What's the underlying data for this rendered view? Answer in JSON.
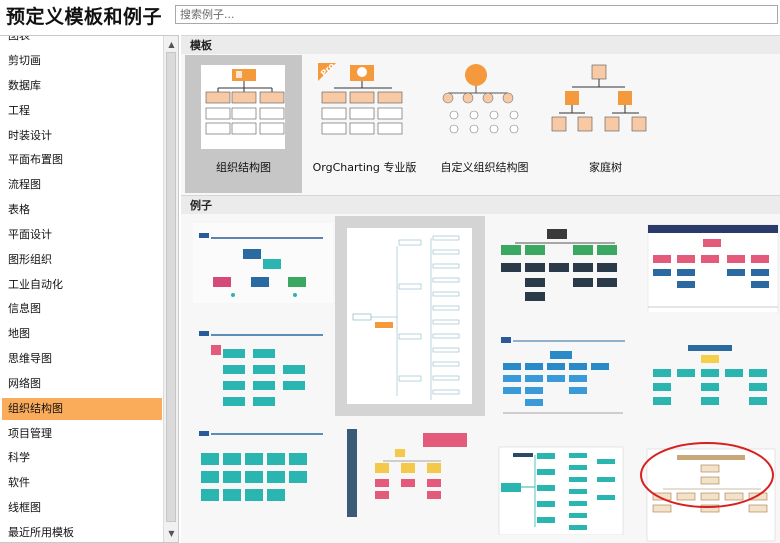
{
  "header": {
    "title": "预定义模板和例子",
    "search_placeholder": "搜索例子..."
  },
  "sidebar": {
    "items": [
      "图表",
      "剪切画",
      "数据库",
      "工程",
      "时装设计",
      "平面布置图",
      "流程图",
      "表格",
      "平面设计",
      "图形组织",
      "工业自动化",
      "信息图",
      "地图",
      "思维导图",
      "网络图",
      "组织结构图",
      "项目管理",
      "科学",
      "软件",
      "线框图",
      "最近所用模板"
    ],
    "active_item": "组织结构图"
  },
  "main": {
    "templates_header": "模板",
    "examples_header": "例子",
    "templates": [
      {
        "label": "组织结构图",
        "selected": true
      },
      {
        "label": "OrgCharting 专业版",
        "badge": "Pro"
      },
      {
        "label": "自定义组织结构图"
      },
      {
        "label": "家庭树"
      }
    ],
    "example_count": 12
  },
  "colors": {
    "accent": "#fbac5a",
    "selected_gray": "#c6c6c6",
    "teal": "#2bb5b0",
    "annotation_red": "#d92020"
  }
}
